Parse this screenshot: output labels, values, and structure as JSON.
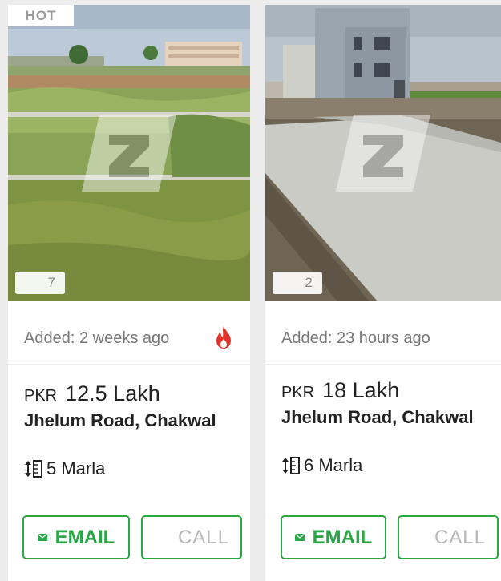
{
  "listings": [
    {
      "badge": "HOT",
      "photo_count": "7",
      "added": "Added: 2 weeks ago",
      "currency": "PKR",
      "price": "12.5 Lakh",
      "location": "Jhelum Road, Chakwal",
      "area": "5 Marla",
      "email_label": "EMAIL",
      "call_label": "CALL"
    },
    {
      "photo_count": "2",
      "added": "Added: 23 hours ago",
      "currency": "PKR",
      "price": "18 Lakh",
      "location": "Jhelum Road, Chakwal",
      "area": "6 Marla",
      "email_label": "EMAIL",
      "call_label": "CALL"
    }
  ],
  "colors": {
    "accent": "#28a745",
    "hot_icon": "#e0342c",
    "muted_text": "#777777"
  },
  "icons": [
    "fire-icon",
    "mail-icon",
    "area-icon",
    "watermark-logo"
  ]
}
